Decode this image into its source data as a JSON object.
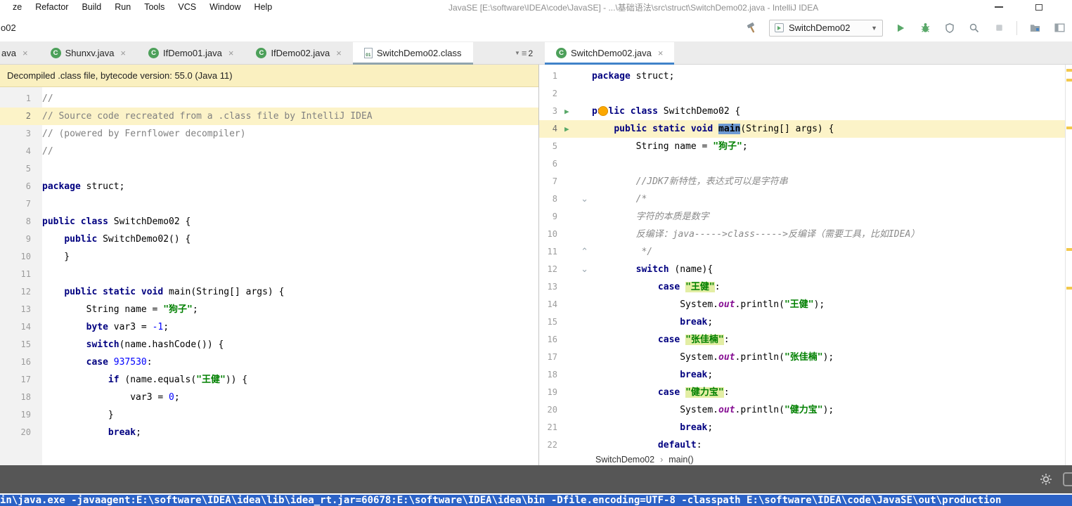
{
  "window": {
    "menus": [
      "ze",
      "Refactor",
      "Build",
      "Run",
      "Tools",
      "VCS",
      "Window",
      "Help"
    ],
    "title": "JavaSE [E:\\software\\IDEA\\code\\JavaSE] - ...\\基础语法\\src\\struct\\SwitchDemo02.java - IntelliJ IDEA"
  },
  "toolbar": {
    "breadcrumb": "o02",
    "run_config": "SwitchDemo02"
  },
  "tabs": {
    "left": [
      {
        "label": "ava",
        "icon": null,
        "close": true,
        "active": false
      },
      {
        "label": "Shunxv.java",
        "icon": "class",
        "close": true,
        "active": false
      },
      {
        "label": "IfDemo01.java",
        "icon": "class",
        "close": true,
        "active": false
      },
      {
        "label": "IfDemo02.java",
        "icon": "class",
        "close": true,
        "active": false
      },
      {
        "label": "SwitchDemo02.class",
        "icon": "classfile",
        "close": false,
        "active": true,
        "focus": "dim"
      }
    ],
    "right": [
      {
        "label": "SwitchDemo02.java",
        "icon": "class",
        "close": true,
        "active": true,
        "focus": "blue"
      }
    ],
    "overflow_count": "2"
  },
  "banner": {
    "text": "Decompiled .class file, bytecode version: 55.0 (Java 11)"
  },
  "left_editor": {
    "current_line": 2,
    "lines": [
      [
        [
          "c",
          "//"
        ]
      ],
      [
        [
          "c",
          "// Source code recreated from a .class file by IntelliJ IDEA"
        ]
      ],
      [
        [
          "c",
          "// (powered by Fernflower decompiler)"
        ]
      ],
      [
        [
          "c",
          "//"
        ]
      ],
      [],
      [
        [
          "k",
          "package"
        ],
        [
          "t",
          " struct;"
        ]
      ],
      [],
      [
        [
          "k",
          "public"
        ],
        [
          "t",
          " "
        ],
        [
          "k",
          "class"
        ],
        [
          "t",
          " SwitchDemo02 {"
        ]
      ],
      [
        [
          "t",
          "    "
        ],
        [
          "k",
          "public"
        ],
        [
          "t",
          " SwitchDemo02() {"
        ]
      ],
      [
        [
          "t",
          "    }"
        ]
      ],
      [],
      [
        [
          "t",
          "    "
        ],
        [
          "k",
          "public"
        ],
        [
          "t",
          " "
        ],
        [
          "k",
          "static"
        ],
        [
          "t",
          " "
        ],
        [
          "k",
          "void"
        ],
        [
          "t",
          " main(String[] args) {"
        ]
      ],
      [
        [
          "t",
          "        String name = "
        ],
        [
          "s",
          "\"狗子\""
        ],
        [
          "t",
          ";"
        ]
      ],
      [
        [
          "t",
          "        "
        ],
        [
          "k",
          "byte"
        ],
        [
          "t",
          " var3 = "
        ],
        [
          "n",
          "-1"
        ],
        [
          "t",
          ";"
        ]
      ],
      [
        [
          "t",
          "        "
        ],
        [
          "k",
          "switch"
        ],
        [
          "t",
          "(name.hashCode()) {"
        ]
      ],
      [
        [
          "t",
          "        "
        ],
        [
          "k",
          "case"
        ],
        [
          "t",
          " "
        ],
        [
          "n",
          "937530"
        ],
        [
          "t",
          ":"
        ]
      ],
      [
        [
          "t",
          "            "
        ],
        [
          "k",
          "if"
        ],
        [
          "t",
          " (name.equals("
        ],
        [
          "s",
          "\"王健\""
        ],
        [
          "t",
          ")) {"
        ]
      ],
      [
        [
          "t",
          "                var3 = "
        ],
        [
          "n",
          "0"
        ],
        [
          "t",
          ";"
        ]
      ],
      [
        [
          "t",
          "            }"
        ]
      ],
      [
        [
          "t",
          "            "
        ],
        [
          "k",
          "break"
        ],
        [
          "t",
          ";"
        ]
      ]
    ]
  },
  "right_editor": {
    "current_line": 4,
    "run_lines": [
      3,
      4
    ],
    "bulb_line": 3,
    "folds": {
      "8": "down",
      "11": "up",
      "12": "down"
    },
    "lines": [
      [
        [
          "k",
          "package"
        ],
        [
          "t",
          " struct;"
        ]
      ],
      [],
      [
        [
          "k",
          "public"
        ],
        [
          "t",
          " "
        ],
        [
          "k",
          "class"
        ],
        [
          "t",
          " SwitchDemo02 {"
        ]
      ],
      [
        [
          "t",
          "    "
        ],
        [
          "k",
          "public"
        ],
        [
          "t",
          " "
        ],
        [
          "k",
          "static"
        ],
        [
          "t",
          " "
        ],
        [
          "k",
          "void"
        ],
        [
          "t",
          " "
        ],
        [
          "sel",
          "main"
        ],
        [
          "t",
          "(String[] args) {"
        ]
      ],
      [
        [
          "t",
          "        String name = "
        ],
        [
          "s",
          "\"狗子\""
        ],
        [
          "t",
          ";"
        ]
      ],
      [],
      [
        [
          "t",
          "        "
        ],
        [
          "ci",
          "//JDK7新特性，表达式可以是字符串"
        ]
      ],
      [
        [
          "t",
          "        "
        ],
        [
          "ci",
          "/*"
        ]
      ],
      [
        [
          "t",
          "        "
        ],
        [
          "ci",
          "字符的本质是数字"
        ]
      ],
      [
        [
          "t",
          "        "
        ],
        [
          "ci",
          "反编译：java----->class----->反编译（需要工具，比如IDEA）"
        ]
      ],
      [
        [
          "t",
          "         "
        ],
        [
          "ci",
          "*/"
        ]
      ],
      [
        [
          "t",
          "        "
        ],
        [
          "k",
          "switch"
        ],
        [
          "t",
          " (name){"
        ]
      ],
      [
        [
          "t",
          "            "
        ],
        [
          "k",
          "case"
        ],
        [
          "t",
          " "
        ],
        [
          "shl",
          "\"王健\""
        ],
        [
          "t",
          ":"
        ]
      ],
      [
        [
          "t",
          "                System."
        ],
        [
          "fld",
          "out"
        ],
        [
          "t",
          ".println("
        ],
        [
          "s",
          "\"王健\""
        ],
        [
          "t",
          ");"
        ]
      ],
      [
        [
          "t",
          "                "
        ],
        [
          "k",
          "break"
        ],
        [
          "t",
          ";"
        ]
      ],
      [
        [
          "t",
          "            "
        ],
        [
          "k",
          "case"
        ],
        [
          "t",
          " "
        ],
        [
          "shl",
          "\"张佳楠\""
        ],
        [
          "t",
          ":"
        ]
      ],
      [
        [
          "t",
          "                System."
        ],
        [
          "fld",
          "out"
        ],
        [
          "t",
          ".println("
        ],
        [
          "s",
          "\"张佳楠\""
        ],
        [
          "t",
          ");"
        ]
      ],
      [
        [
          "t",
          "                "
        ],
        [
          "k",
          "break"
        ],
        [
          "t",
          ";"
        ]
      ],
      [
        [
          "t",
          "            "
        ],
        [
          "k",
          "case"
        ],
        [
          "t",
          " "
        ],
        [
          "shl",
          "\"健力宝\""
        ],
        [
          "t",
          ":"
        ]
      ],
      [
        [
          "t",
          "                System."
        ],
        [
          "fld",
          "out"
        ],
        [
          "t",
          ".println("
        ],
        [
          "s",
          "\"健力宝\""
        ],
        [
          "t",
          ");"
        ]
      ],
      [
        [
          "t",
          "                "
        ],
        [
          "k",
          "break"
        ],
        [
          "t",
          ";"
        ]
      ],
      [
        [
          "t",
          "            "
        ],
        [
          "k",
          "default"
        ],
        [
          "t",
          ":"
        ]
      ]
    ]
  },
  "breadcrumbs": {
    "items": [
      "SwitchDemo02",
      "main()"
    ],
    "sep": "›"
  },
  "console": {
    "text": "in\\java.exe -javaagent:E:\\software\\IDEA\\idea\\lib\\idea_rt.jar=60678:E:\\software\\IDEA\\idea\\bin -Dfile.encoding=UTF-8 -classpath E:\\software\\IDEA\\code\\JavaSE\\out\\production"
  },
  "icons": {
    "class_letter": "C",
    "classfile_mark": "01",
    "close": "×",
    "run_arrow": "▶",
    "fold_down": "⌄",
    "fold_up": "⌃",
    "caret_down": "▼",
    "overflow_lines": "≡"
  },
  "error_stripe": {
    "marks": [
      6,
      20,
      88,
      261,
      316
    ]
  },
  "colors": {
    "accent_blue": "#4083C9",
    "run_green": "#59A869",
    "banner_bg": "#FAF0C0",
    "console_blue": "#2B62C6",
    "stripe_yellow": "#F2C84B",
    "current_line": "#FCF3C8"
  }
}
